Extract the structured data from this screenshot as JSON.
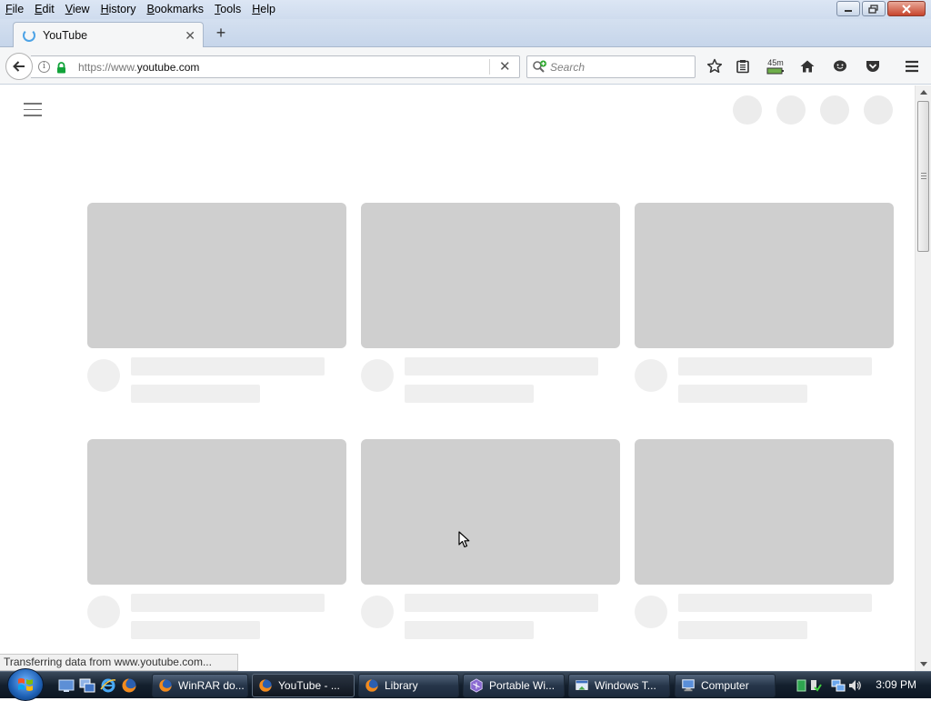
{
  "menubar": {
    "items": [
      "File",
      "Edit",
      "View",
      "History",
      "Bookmarks",
      "Tools",
      "Help"
    ]
  },
  "tab": {
    "title": "YouTube"
  },
  "navbar": {
    "url_prefix": "https://www.",
    "url_host": "youtube.com",
    "search_placeholder": "Search",
    "timer_badge": "45m"
  },
  "status_text": "Transferring data from www.youtube.com...",
  "taskbar": {
    "items": [
      {
        "label": "WinRAR do...",
        "icon": "firefox-icon"
      },
      {
        "label": "YouTube - ...",
        "icon": "firefox-icon"
      },
      {
        "label": "Library",
        "icon": "firefox-icon"
      },
      {
        "label": "Portable Wi...",
        "icon": "app-icon"
      },
      {
        "label": "Windows T...",
        "icon": "window-icon"
      },
      {
        "label": "Computer",
        "icon": "computer-icon"
      }
    ],
    "clock": "3:09 PM"
  },
  "colors": {
    "placeholder_thumb": "#cfcfcf",
    "placeholder_text": "#efefef",
    "chrome_bg": "#f5f6f7"
  }
}
